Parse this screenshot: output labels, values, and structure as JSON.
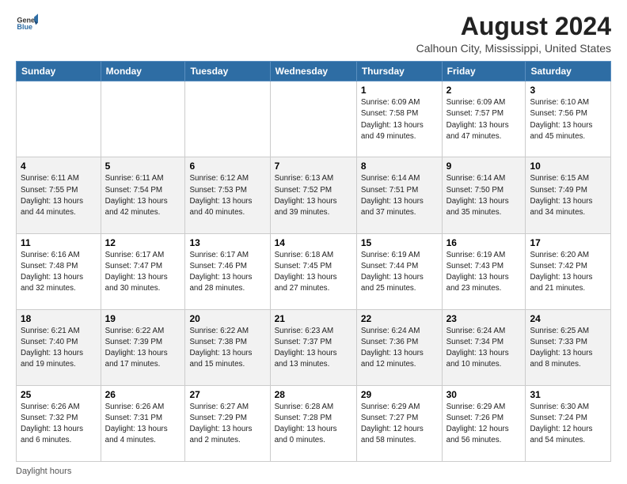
{
  "logo": {
    "line1": "General",
    "line2": "Blue",
    "icon_color": "#2e6da4"
  },
  "title": "August 2024",
  "subtitle": "Calhoun City, Mississippi, United States",
  "days_of_week": [
    "Sunday",
    "Monday",
    "Tuesday",
    "Wednesday",
    "Thursday",
    "Friday",
    "Saturday"
  ],
  "weeks": [
    [
      {
        "day": "",
        "info": ""
      },
      {
        "day": "",
        "info": ""
      },
      {
        "day": "",
        "info": ""
      },
      {
        "day": "",
        "info": ""
      },
      {
        "day": "1",
        "info": "Sunrise: 6:09 AM\nSunset: 7:58 PM\nDaylight: 13 hours\nand 49 minutes."
      },
      {
        "day": "2",
        "info": "Sunrise: 6:09 AM\nSunset: 7:57 PM\nDaylight: 13 hours\nand 47 minutes."
      },
      {
        "day": "3",
        "info": "Sunrise: 6:10 AM\nSunset: 7:56 PM\nDaylight: 13 hours\nand 45 minutes."
      }
    ],
    [
      {
        "day": "4",
        "info": "Sunrise: 6:11 AM\nSunset: 7:55 PM\nDaylight: 13 hours\nand 44 minutes."
      },
      {
        "day": "5",
        "info": "Sunrise: 6:11 AM\nSunset: 7:54 PM\nDaylight: 13 hours\nand 42 minutes."
      },
      {
        "day": "6",
        "info": "Sunrise: 6:12 AM\nSunset: 7:53 PM\nDaylight: 13 hours\nand 40 minutes."
      },
      {
        "day": "7",
        "info": "Sunrise: 6:13 AM\nSunset: 7:52 PM\nDaylight: 13 hours\nand 39 minutes."
      },
      {
        "day": "8",
        "info": "Sunrise: 6:14 AM\nSunset: 7:51 PM\nDaylight: 13 hours\nand 37 minutes."
      },
      {
        "day": "9",
        "info": "Sunrise: 6:14 AM\nSunset: 7:50 PM\nDaylight: 13 hours\nand 35 minutes."
      },
      {
        "day": "10",
        "info": "Sunrise: 6:15 AM\nSunset: 7:49 PM\nDaylight: 13 hours\nand 34 minutes."
      }
    ],
    [
      {
        "day": "11",
        "info": "Sunrise: 6:16 AM\nSunset: 7:48 PM\nDaylight: 13 hours\nand 32 minutes."
      },
      {
        "day": "12",
        "info": "Sunrise: 6:17 AM\nSunset: 7:47 PM\nDaylight: 13 hours\nand 30 minutes."
      },
      {
        "day": "13",
        "info": "Sunrise: 6:17 AM\nSunset: 7:46 PM\nDaylight: 13 hours\nand 28 minutes."
      },
      {
        "day": "14",
        "info": "Sunrise: 6:18 AM\nSunset: 7:45 PM\nDaylight: 13 hours\nand 27 minutes."
      },
      {
        "day": "15",
        "info": "Sunrise: 6:19 AM\nSunset: 7:44 PM\nDaylight: 13 hours\nand 25 minutes."
      },
      {
        "day": "16",
        "info": "Sunrise: 6:19 AM\nSunset: 7:43 PM\nDaylight: 13 hours\nand 23 minutes."
      },
      {
        "day": "17",
        "info": "Sunrise: 6:20 AM\nSunset: 7:42 PM\nDaylight: 13 hours\nand 21 minutes."
      }
    ],
    [
      {
        "day": "18",
        "info": "Sunrise: 6:21 AM\nSunset: 7:40 PM\nDaylight: 13 hours\nand 19 minutes."
      },
      {
        "day": "19",
        "info": "Sunrise: 6:22 AM\nSunset: 7:39 PM\nDaylight: 13 hours\nand 17 minutes."
      },
      {
        "day": "20",
        "info": "Sunrise: 6:22 AM\nSunset: 7:38 PM\nDaylight: 13 hours\nand 15 minutes."
      },
      {
        "day": "21",
        "info": "Sunrise: 6:23 AM\nSunset: 7:37 PM\nDaylight: 13 hours\nand 13 minutes."
      },
      {
        "day": "22",
        "info": "Sunrise: 6:24 AM\nSunset: 7:36 PM\nDaylight: 13 hours\nand 12 minutes."
      },
      {
        "day": "23",
        "info": "Sunrise: 6:24 AM\nSunset: 7:34 PM\nDaylight: 13 hours\nand 10 minutes."
      },
      {
        "day": "24",
        "info": "Sunrise: 6:25 AM\nSunset: 7:33 PM\nDaylight: 13 hours\nand 8 minutes."
      }
    ],
    [
      {
        "day": "25",
        "info": "Sunrise: 6:26 AM\nSunset: 7:32 PM\nDaylight: 13 hours\nand 6 minutes."
      },
      {
        "day": "26",
        "info": "Sunrise: 6:26 AM\nSunset: 7:31 PM\nDaylight: 13 hours\nand 4 minutes."
      },
      {
        "day": "27",
        "info": "Sunrise: 6:27 AM\nSunset: 7:29 PM\nDaylight: 13 hours\nand 2 minutes."
      },
      {
        "day": "28",
        "info": "Sunrise: 6:28 AM\nSunset: 7:28 PM\nDaylight: 13 hours\nand 0 minutes."
      },
      {
        "day": "29",
        "info": "Sunrise: 6:29 AM\nSunset: 7:27 PM\nDaylight: 12 hours\nand 58 minutes."
      },
      {
        "day": "30",
        "info": "Sunrise: 6:29 AM\nSunset: 7:26 PM\nDaylight: 12 hours\nand 56 minutes."
      },
      {
        "day": "31",
        "info": "Sunrise: 6:30 AM\nSunset: 7:24 PM\nDaylight: 12 hours\nand 54 minutes."
      }
    ]
  ],
  "footer": "Daylight hours"
}
